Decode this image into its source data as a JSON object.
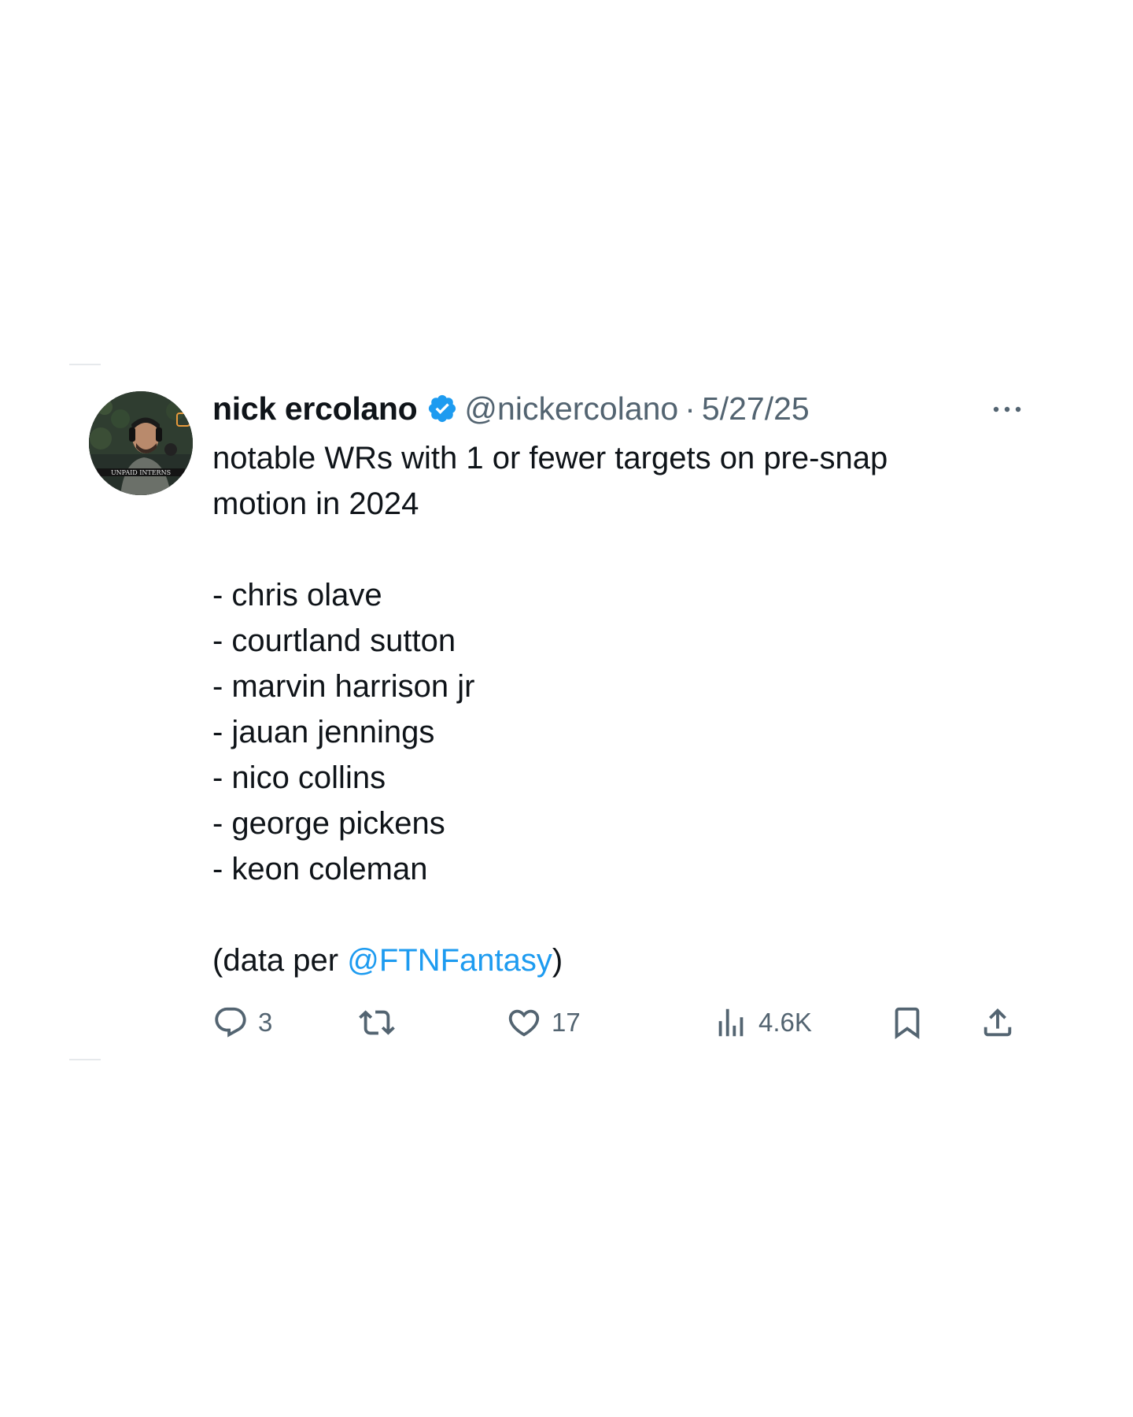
{
  "user": {
    "name": "nick ercolano",
    "handle": "@nickercolano",
    "separator": "·",
    "date": "5/27/25",
    "avatar_text": "UNPAID INTERNS"
  },
  "tweet": {
    "intro_line1": "notable WRs with 1 or fewer targets on pre-snap",
    "intro_line2": "motion in 2024",
    "players": [
      "- chris olave",
      "- courtland sutton",
      "- marvin harrison jr",
      "- jauan jennings",
      "- nico collins",
      "- george pickens",
      "- keon coleman"
    ],
    "source_prefix": "(data per ",
    "source_mention": "@FTNFantasy",
    "source_suffix": ")"
  },
  "stats": {
    "replies": "3",
    "reposts": "",
    "likes": "17",
    "views": "4.6K"
  },
  "icons": {
    "verified": "verified-badge-icon",
    "more": "more-icon",
    "reply": "reply-icon",
    "repost": "repost-icon",
    "like": "heart-icon",
    "views": "views-icon",
    "bookmark": "bookmark-icon",
    "share": "share-icon"
  },
  "colors": {
    "text": "#0f1419",
    "secondary": "#536471",
    "accent": "#1d9bf0"
  }
}
